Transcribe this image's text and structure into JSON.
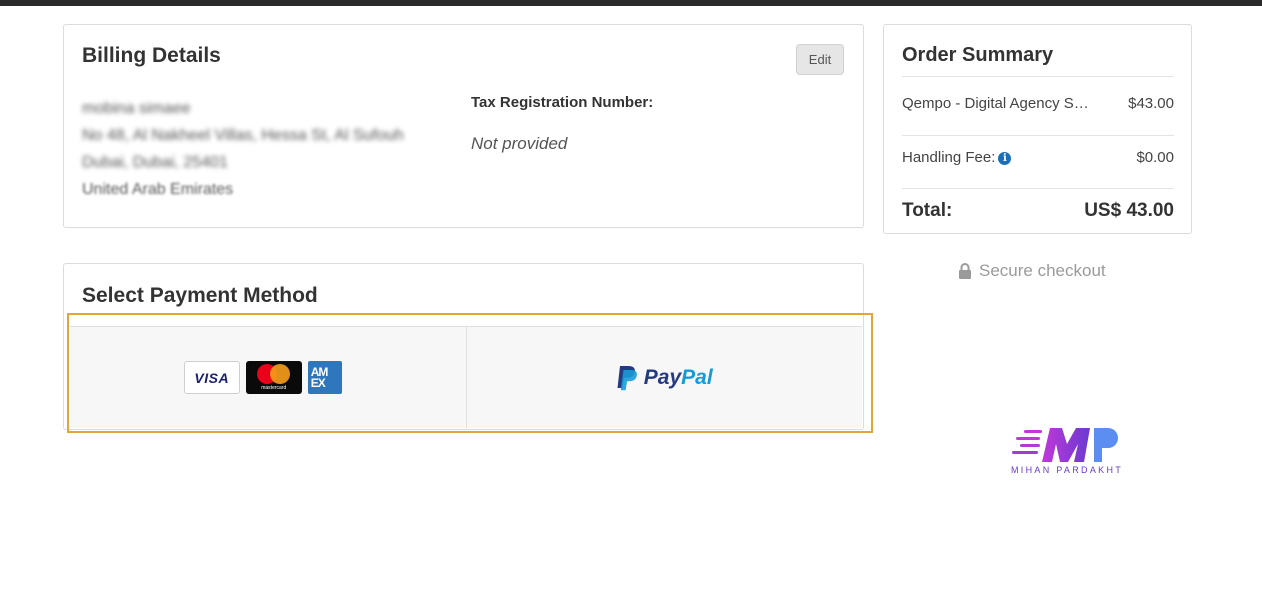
{
  "billing": {
    "title": "Billing Details",
    "edit_label": "Edit",
    "address_lines": [
      "mobina simaee",
      "No 48, Al Nakheel Villas, Hessa St, Al Sufouh",
      "Dubai, Dubai, 25401",
      "United Arab Emirates"
    ],
    "tax_label": "Tax Registration Number:",
    "tax_value": "Not provided"
  },
  "payment": {
    "title": "Select Payment Method",
    "card_brands": [
      "VISA",
      "mastercard",
      "AM EX"
    ],
    "paypal": {
      "part1": "Pay",
      "part2": "Pal"
    },
    "highlight_color": "#e6a23c"
  },
  "summary": {
    "title": "Order Summary",
    "item_label": "Qempo - Digital Agency S…",
    "item_price": "$43.00",
    "fee_label": "Handling Fee:",
    "fee_value": "$0.00",
    "total_label": "Total:",
    "total_value": "US$ 43.00"
  },
  "secure_label": "Secure checkout",
  "watermark": {
    "text": "MIHAN PARDAKHT"
  },
  "colors": {
    "accent_orange": "#e6a23c",
    "paypal_dark": "#253b80",
    "paypal_light": "#179bd7",
    "info_blue": "#1a6fb8"
  }
}
